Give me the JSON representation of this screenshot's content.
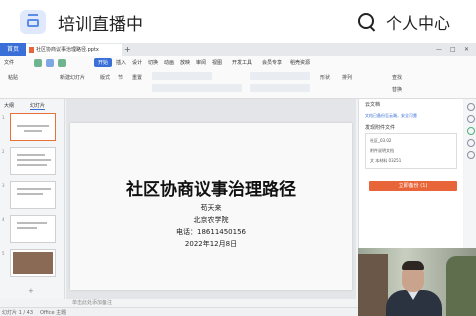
{
  "header": {
    "title": "培训直播中",
    "user_center": "个人中心"
  },
  "wps": {
    "tab_home": "首页",
    "doc_tab": "社区协商议事治理路径.pptx",
    "menu": [
      "文件",
      "开始",
      "插入",
      "设计",
      "切换",
      "动画",
      "放映",
      "审阅",
      "视图",
      "开发工具",
      "会员专享",
      "稻壳资源"
    ],
    "menu_active": "开始",
    "ribbon_labels": [
      "粘贴",
      "新建幻灯片",
      "版式",
      "节",
      "重置",
      "形状",
      "排列",
      "查找",
      "替换"
    ],
    "left_tabs": [
      "大纲",
      "幻灯片"
    ],
    "slide_numbers": [
      "1",
      "2",
      "3",
      "4",
      "5"
    ],
    "add_slide": "+",
    "notes_placeholder": "单击此处添加备注",
    "status_text": "幻灯片 1 / 43",
    "status_theme": "Office 主题"
  },
  "slide": {
    "title": "社区协商议事治理路径",
    "author": "苟天来",
    "org": "北京农学院",
    "phone": "电话：18611450156",
    "date": "2022年12月8日"
  },
  "right_panel": {
    "title": "云文档",
    "link": "文档已备份至云端，安全可靠",
    "subtitle": "发现附件文件",
    "files": [
      "社区_03.02",
      "附件说明文档",
      "文 本材料 03251"
    ],
    "action_button": "立即备份 (1)"
  }
}
